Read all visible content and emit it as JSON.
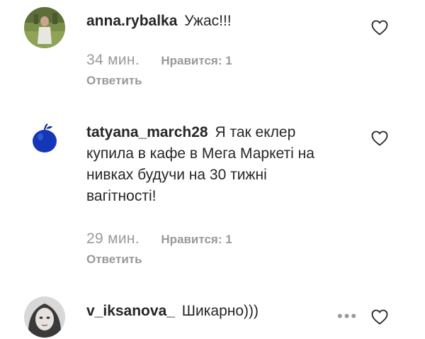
{
  "comments": [
    {
      "username": "anna.rybalka",
      "text": "Ужас!!!",
      "time": "34 мин.",
      "likes": "Нравится: 1",
      "reply": "Ответить",
      "avatar_icon": "profile-photo-person-on-grass"
    },
    {
      "username": "tatyana_march28",
      "text": "Я так еклер купила в кафе в Мега Маркеті на нивках будучи на 30 тижні вагітності!",
      "time": "29 мин.",
      "likes": "Нравится: 1",
      "reply": "Ответить",
      "avatar_icon": "profile-photo-blue-apple"
    },
    {
      "username": "v_iksanova_",
      "text": "Шикарно)))",
      "avatar_icon": "profile-photo-woman-face"
    }
  ],
  "icons": {
    "like": "heart-outline-icon",
    "more": "more-options-icon"
  },
  "colors": {
    "text": "#262626",
    "secondary": "#999999",
    "background": "#ffffff"
  }
}
